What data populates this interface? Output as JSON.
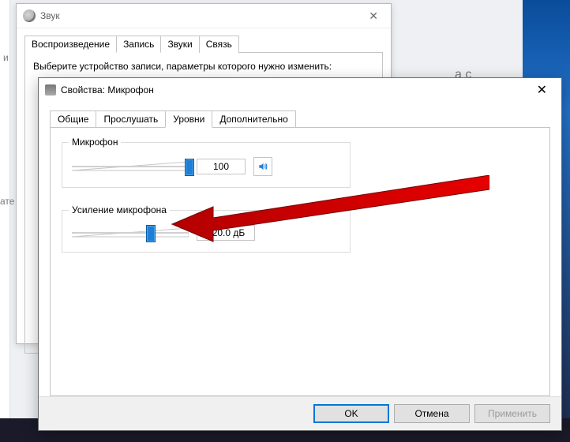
{
  "bg": {
    "fragment1": "а с",
    "fragment2": "и",
    "fragment3": "ате"
  },
  "sound_win": {
    "title": "Звук",
    "tabs": {
      "playback": "Воспроизведение",
      "recording": "Запись",
      "sounds": "Звуки",
      "comm": "Связь"
    },
    "instruction": "Выберите устройство записи, параметры которого нужно изменить:"
  },
  "props_win": {
    "title": "Свойства: Микрофон",
    "tabs": {
      "general": "Общие",
      "listen": "Прослушать",
      "levels": "Уровни",
      "advanced": "Дополнительно"
    },
    "mic": {
      "label": "Микрофон",
      "value": "100",
      "pct": 100
    },
    "boost": {
      "label": "Усиление микрофона",
      "value": "+20.0 дБ",
      "pct": 67
    },
    "buttons": {
      "ok": "OK",
      "cancel": "Отмена",
      "apply": "Применить"
    }
  }
}
